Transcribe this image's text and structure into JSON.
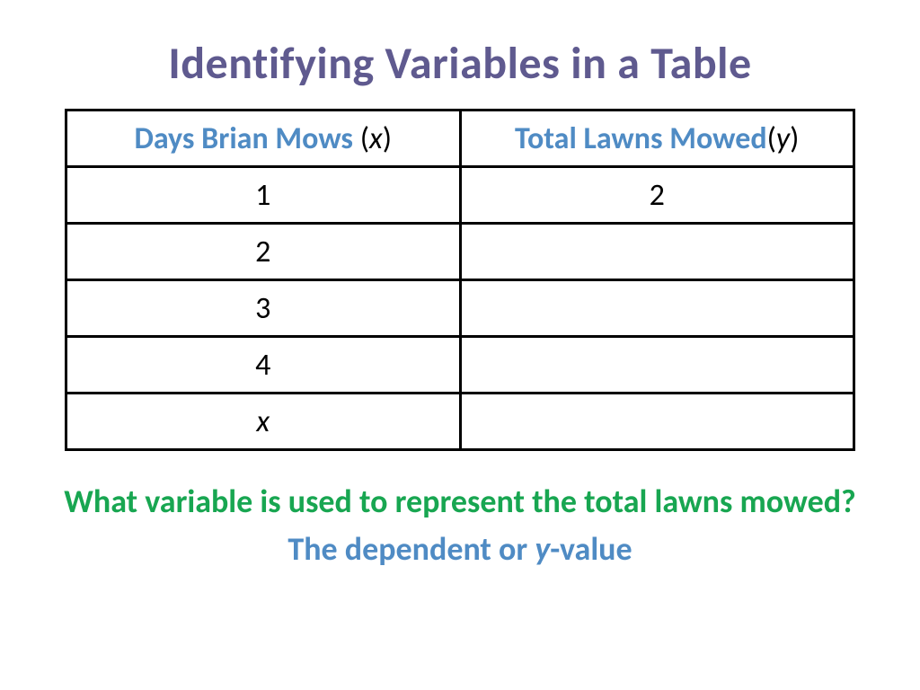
{
  "title": "Identifying Variables in a Table",
  "headers": {
    "left_label": "Days Brian Mows ",
    "left_var_open": "(",
    "left_var": "x",
    "left_var_close": ")",
    "right_label": "Total Lawns Mowed",
    "right_var_open": "(",
    "right_var": "y",
    "right_var_close": ")"
  },
  "rows": [
    {
      "x": "1",
      "y": "2",
      "x_italic": false
    },
    {
      "x": "2",
      "y": "",
      "x_italic": false
    },
    {
      "x": "3",
      "y": "",
      "x_italic": false
    },
    {
      "x": "4",
      "y": "",
      "x_italic": false
    },
    {
      "x": "x",
      "y": "",
      "x_italic": true
    }
  ],
  "question": "What variable is used to represent the total lawns mowed?",
  "answer_pre": "The dependent or ",
  "answer_var": "y",
  "answer_post": "-value",
  "chart_data": {
    "type": "table",
    "columns": [
      "Days Brian Mows (x)",
      "Total Lawns Mowed (y)"
    ],
    "rows": [
      [
        "1",
        "2"
      ],
      [
        "2",
        ""
      ],
      [
        "3",
        ""
      ],
      [
        "4",
        ""
      ],
      [
        "x",
        ""
      ]
    ]
  }
}
